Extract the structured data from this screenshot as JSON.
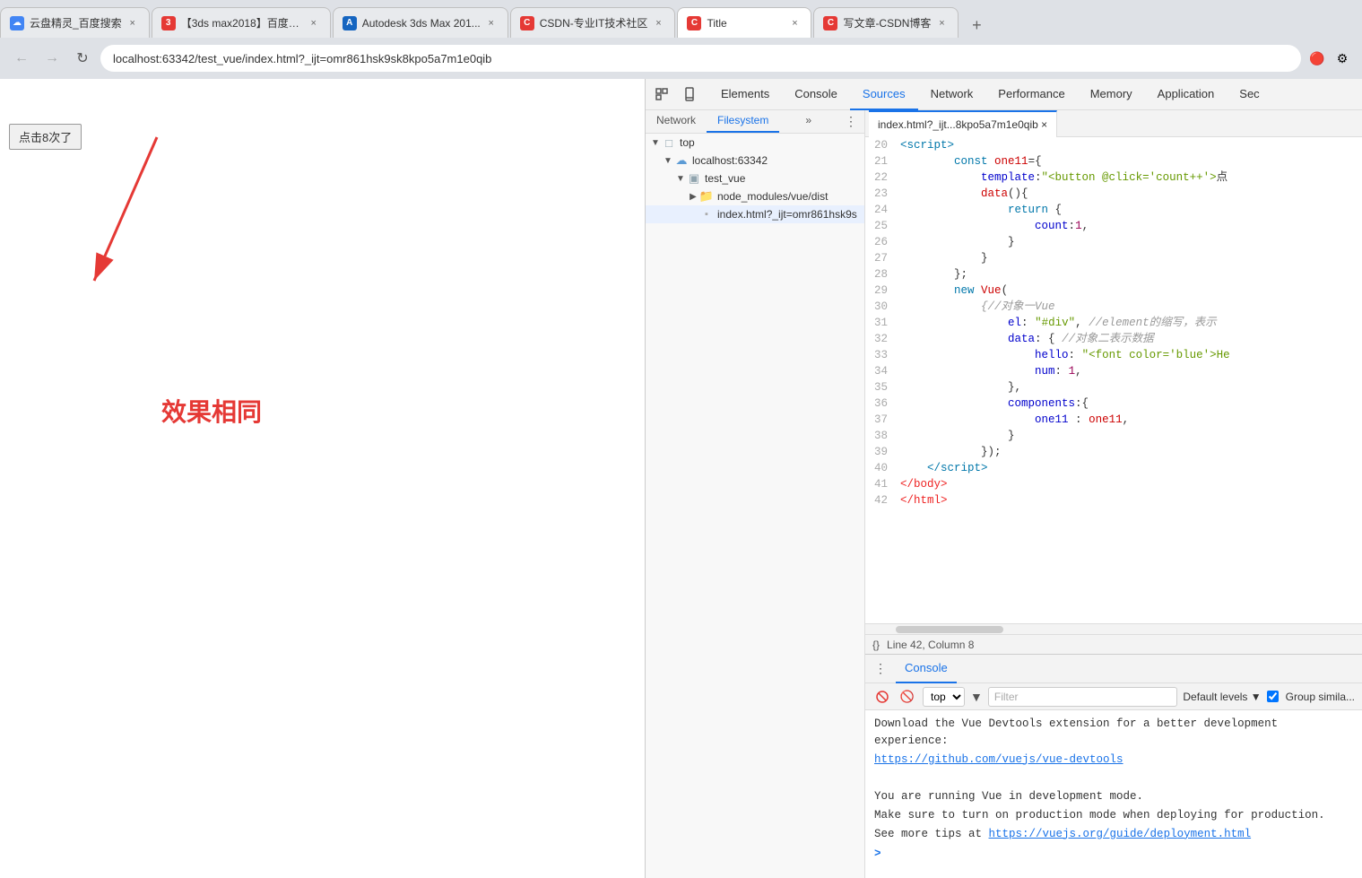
{
  "tabs": [
    {
      "id": "tab1",
      "title": "云盘精灵_百度搜索",
      "favicon_color": "#4285f4",
      "favicon_text": "☁",
      "active": false
    },
    {
      "id": "tab2",
      "title": "【3ds max2018】百度z...",
      "favicon_color": "#e53935",
      "favicon_text": "3",
      "active": false
    },
    {
      "id": "tab3",
      "title": "Autodesk 3ds Max 201...",
      "favicon_color": "#1565c0",
      "favicon_text": "A",
      "active": false
    },
    {
      "id": "tab4",
      "title": "CSDN-专业IT技术社区",
      "favicon_color": "#e53935",
      "favicon_text": "C",
      "active": false
    },
    {
      "id": "tab5",
      "title": "Title",
      "favicon_color": "#e53935",
      "favicon_text": "C",
      "active": true
    },
    {
      "id": "tab6",
      "title": "写文章-CSDN博客",
      "favicon_color": "#e53935",
      "favicon_text": "C",
      "active": false
    }
  ],
  "address_bar": {
    "url": "localhost:63342/test_vue/index.html?_ijt=omr861hsk9sk8kpo5a7m1e0qib"
  },
  "webpage": {
    "button_label": "点击8次了",
    "effect_text": "效果相同"
  },
  "devtools": {
    "tabs": [
      {
        "label": "Elements",
        "active": false
      },
      {
        "label": "Console",
        "active": false
      },
      {
        "label": "Sources",
        "active": true
      },
      {
        "label": "Network",
        "active": false
      },
      {
        "label": "Performance",
        "active": false
      },
      {
        "label": "Memory",
        "active": false
      },
      {
        "label": "Application",
        "active": false
      },
      {
        "label": "Sec",
        "active": false
      }
    ],
    "sources_panel": {
      "tree_tabs": [
        {
          "label": "Network",
          "active": false
        },
        {
          "label": "Filesystem",
          "active": true
        }
      ],
      "file_tree": [
        {
          "level": 0,
          "arrow": "▼",
          "type": "folder",
          "label": "top"
        },
        {
          "level": 1,
          "arrow": "▼",
          "type": "cloud-folder",
          "label": "localhost:63342"
        },
        {
          "level": 2,
          "arrow": "▼",
          "type": "folder",
          "label": "test_vue"
        },
        {
          "level": 3,
          "arrow": "▶",
          "type": "folder-blue",
          "label": "node_modules/vue/dist"
        },
        {
          "level": 3,
          "arrow": "",
          "type": "file",
          "label": "index.html?_ijt=omr861hsk9s"
        }
      ],
      "active_file_tab": "index.html?_ijt...8kpo5a7m1e0qib ×",
      "code_lines": [
        {
          "num": 20,
          "html": "<span class='kw'>&lt;script&gt;</span>"
        },
        {
          "num": 21,
          "html": "        <span class='kw'>const</span> <span class='fn'>one11</span>={"
        },
        {
          "num": 22,
          "html": "            <span class='attr'>template</span>:<span class='str'>\"&lt;button @click='count++'&gt;点</span>"
        },
        {
          "num": 23,
          "html": "            <span class='fn'>data</span>(){"
        },
        {
          "num": 24,
          "html": "                <span class='kw'>return</span> {"
        },
        {
          "num": 25,
          "html": "                    <span class='attr'>count</span>:<span class='num'>1</span>,"
        },
        {
          "num": 26,
          "html": "                }"
        },
        {
          "num": 27,
          "html": "            }"
        },
        {
          "num": 28,
          "html": "        };"
        },
        {
          "num": 29,
          "html": "        <span class='kw'>new</span> <span class='fn'>Vue</span>("
        },
        {
          "num": 30,
          "html": "            <span class='comment'>{//对象一Vue</span>"
        },
        {
          "num": 31,
          "html": "                <span class='attr'>el</span>: <span class='str'>\"#div\"</span>, <span class='comment'>//element的缩写，表示</span>"
        },
        {
          "num": 32,
          "html": "                <span class='attr'>data</span>: { <span class='comment'>//对象二表示数据</span>"
        },
        {
          "num": 33,
          "html": "                    <span class='attr'>hello</span>: <span class='str'>\"&lt;font color='blue'&gt;He</span>"
        },
        {
          "num": 34,
          "html": "                    <span class='attr'>num</span>: <span class='num'>1</span>,"
        },
        {
          "num": 35,
          "html": "                },"
        },
        {
          "num": 36,
          "html": "                <span class='attr'>components</span>:{"
        },
        {
          "num": 37,
          "html": "                    <span class='attr'>one11</span> : <span class='fn'>one11</span>,"
        },
        {
          "num": 38,
          "html": "                }"
        },
        {
          "num": 39,
          "html": "            });"
        },
        {
          "num": 40,
          "html": "    <span class='kw'>&lt;/script&gt;</span>"
        },
        {
          "num": 41,
          "html": "<span class='tag'>&lt;/body&gt;</span>"
        },
        {
          "num": 42,
          "html": "<span class='tag'>&lt;/html&gt;</span>"
        }
      ],
      "status_bar": {
        "line_col": "Line 42, Column 8"
      }
    },
    "console_panel": {
      "toolbar": {
        "context": "top",
        "filter_placeholder": "Filter",
        "default_levels": "Default levels ▼",
        "group_similar": "Group simila..."
      },
      "messages": [
        {
          "text": "Download the Vue Devtools extension for a better development experience:",
          "type": "normal"
        },
        {
          "text": "https://github.com/vuejs/vue-devtools",
          "type": "link"
        },
        {
          "text": "",
          "type": "normal"
        },
        {
          "text": "You are running Vue in development mode.",
          "type": "normal"
        },
        {
          "text": "Make sure to turn on production mode when deploying for production.",
          "type": "normal"
        },
        {
          "text": "See more tips at https://vuejs.org/guide/deployment.html",
          "type": "link-text"
        },
        {
          "text": "",
          "type": "normal"
        }
      ],
      "prompt": ">"
    }
  }
}
